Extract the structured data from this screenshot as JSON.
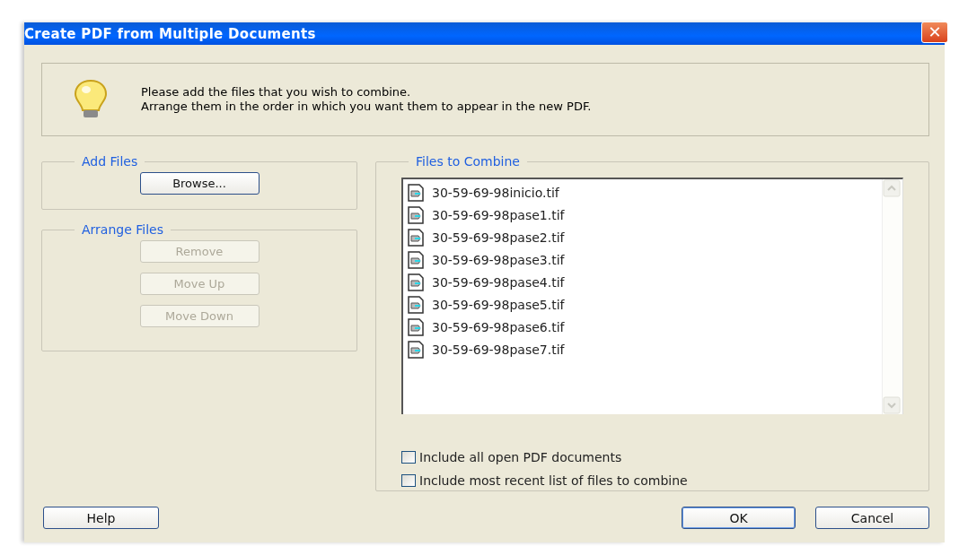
{
  "window": {
    "title": "Create PDF from Multiple Documents",
    "close": "✕"
  },
  "info": {
    "lines": [
      "Please add the files that you wish to combine.",
      "Arrange them in the order in which you want them to appear in the new PDF."
    ]
  },
  "add_files": {
    "title": "Add Files",
    "buttons": [
      {
        "label": "Browse...",
        "disabled": false
      }
    ]
  },
  "arrange_files": {
    "title": "Arrange Files",
    "buttons": [
      {
        "label": "Remove",
        "disabled": true
      },
      {
        "label": "Move Up",
        "disabled": true
      },
      {
        "label": "Move Down",
        "disabled": true
      }
    ]
  },
  "files_to_combine": {
    "title": "Files to Combine",
    "files": [
      {
        "name": "30-59-69-98inicio.tif",
        "selected": false
      },
      {
        "name": "30-59-69-98pase1.tif",
        "selected": false
      },
      {
        "name": "30-59-69-98pase2.tif",
        "selected": false
      },
      {
        "name": "30-59-69-98pase3.tif",
        "selected": false
      },
      {
        "name": "30-59-69-98pase4.tif",
        "selected": false
      },
      {
        "name": "30-59-69-98pase5.tif",
        "selected": false
      },
      {
        "name": "30-59-69-98pase6.tif",
        "selected": false
      },
      {
        "name": "30-59-69-98pase7.tif",
        "selected": false
      }
    ],
    "options": [
      {
        "label": "Include all open PDF documents",
        "checked": false
      },
      {
        "label": "Include most recent list of files to combine",
        "checked": false
      }
    ]
  },
  "footer": {
    "left": [
      {
        "label": "Help",
        "disabled": false,
        "default": false
      }
    ],
    "right": [
      {
        "label": "OK",
        "disabled": false,
        "default": true
      },
      {
        "label": "Cancel",
        "disabled": false,
        "default": false
      }
    ]
  }
}
